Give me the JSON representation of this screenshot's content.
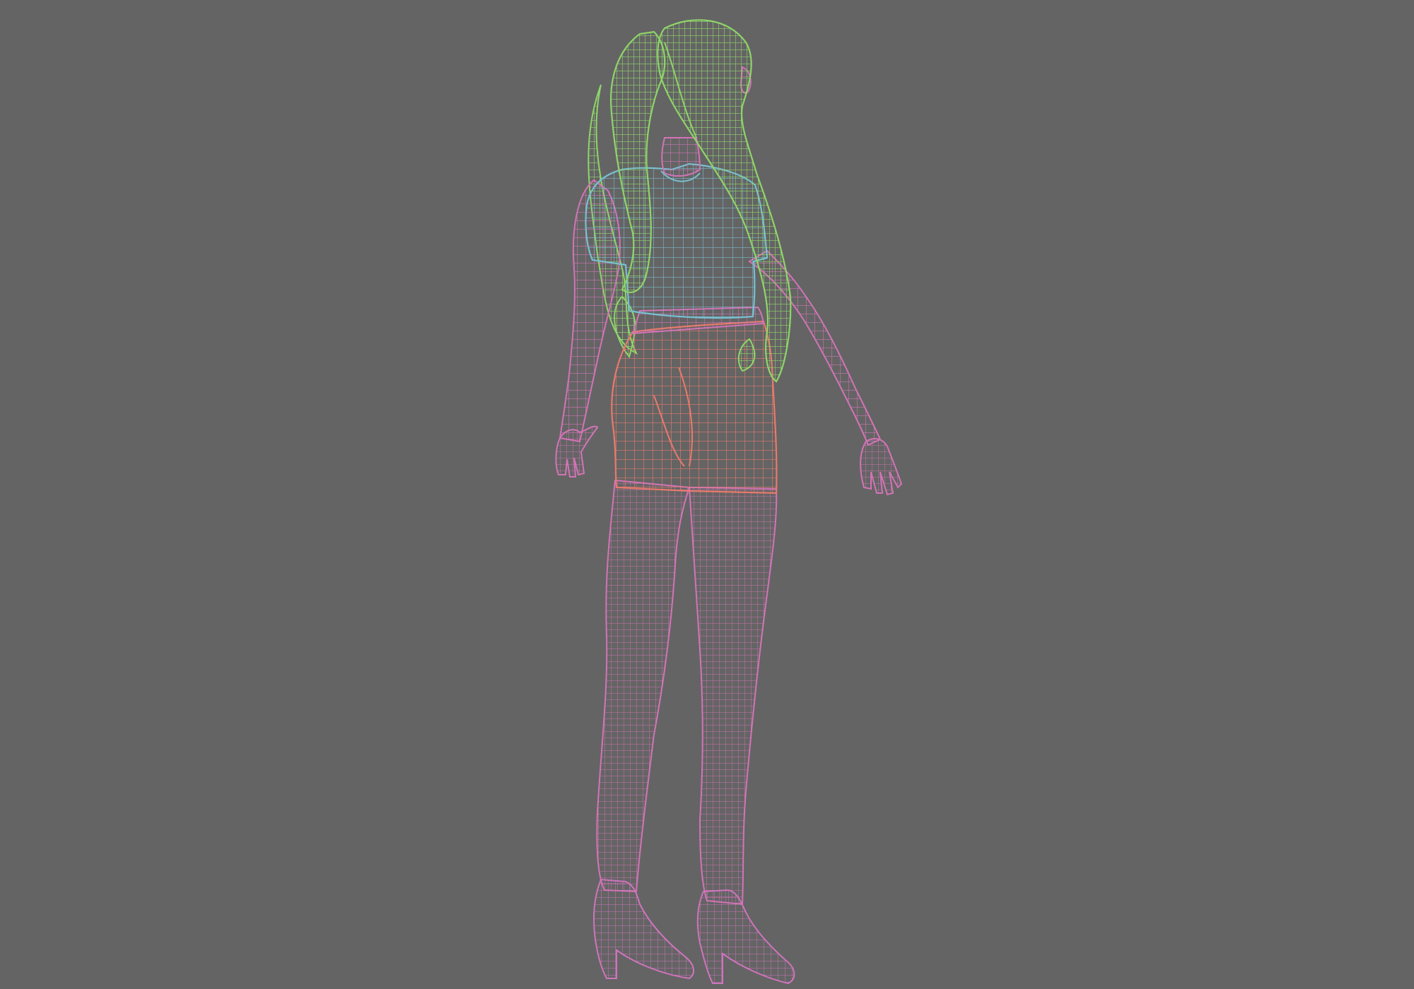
{
  "viewport": {
    "background_color": "#646464"
  },
  "model": {
    "wire_colors": {
      "hair": "#8fd46a",
      "body": "#d274b6",
      "shirt": "#79bfd0",
      "shorts": "#e87a6c",
      "shoes": "#cf74bd"
    }
  }
}
